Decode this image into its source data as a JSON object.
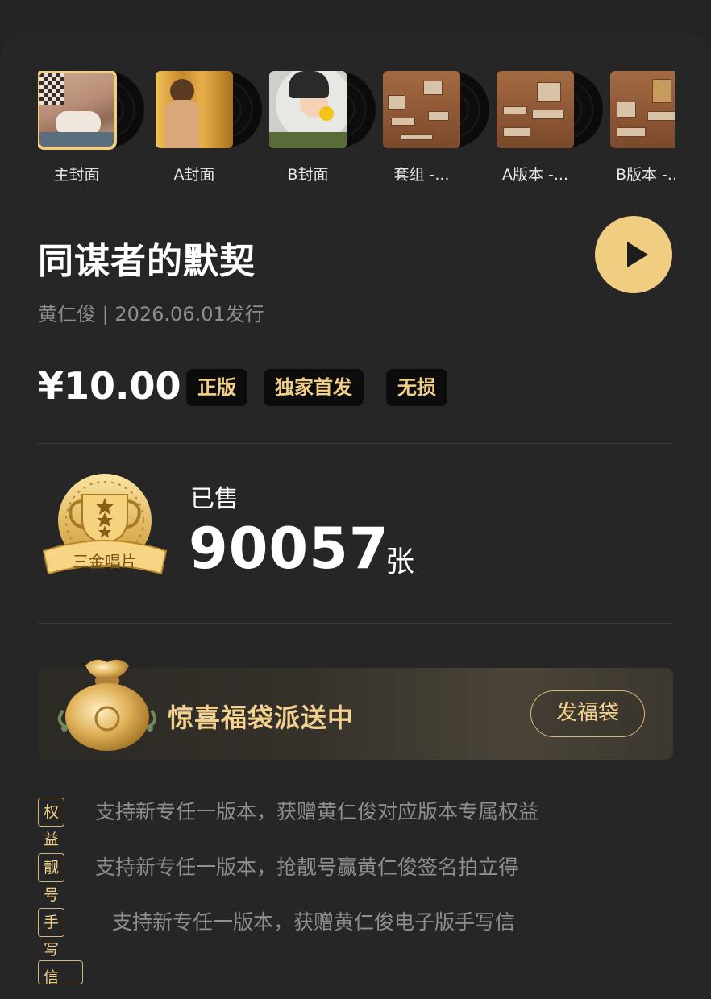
{
  "covers": [
    {
      "label": "主封面",
      "active": true
    },
    {
      "label": "A封面",
      "active": false
    },
    {
      "label": "B封面",
      "active": false
    },
    {
      "label": "套组 -...",
      "active": false
    },
    {
      "label": "A版本 -...",
      "active": false
    },
    {
      "label": "B版本 -...",
      "active": false
    }
  ],
  "album": {
    "title": "同谋者的默契",
    "meta": "黄仁俊 | 2026.06.01发行",
    "price": "¥10.00",
    "tags": [
      "正版",
      "独家首发",
      "无损"
    ]
  },
  "sales": {
    "badge_text": "三金唱片",
    "label": "已售",
    "count": "90057",
    "unit": "张"
  },
  "lucky_bag": {
    "text": "惊喜福袋派送中",
    "button": "发福袋"
  },
  "benefits": [
    {
      "tag": "权益",
      "text": "支持新专任一版本，获赠黄仁俊对应版本专属权益"
    },
    {
      "tag": "靓号",
      "text": "支持新专任一版本，抢靓号赢黄仁俊签名拍立得"
    },
    {
      "tag": "手写信",
      "text": "支持新专任一版本，获赠黄仁俊电子版手写信"
    }
  ],
  "colors": {
    "accent": "#f0cd80",
    "background": "#262626",
    "muted": "#8f8f8f"
  }
}
